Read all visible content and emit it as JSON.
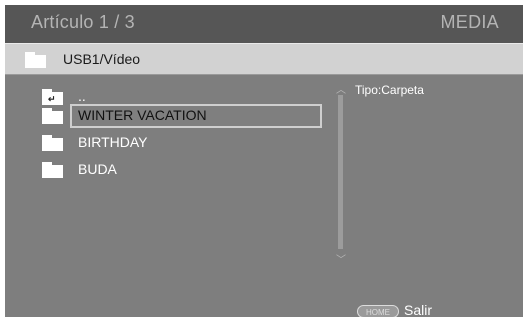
{
  "header": {
    "item_counter": "Artículo 1 / 3",
    "mode": "MEDIA"
  },
  "path": {
    "current": "USB1/Vídeo"
  },
  "list": {
    "items": [
      {
        "label": "..",
        "type": "parent",
        "selected": false
      },
      {
        "label": "WINTER VACATION",
        "type": "folder",
        "selected": true
      },
      {
        "label": "BIRTHDAY",
        "type": "folder",
        "selected": false
      },
      {
        "label": "BUDA",
        "type": "folder",
        "selected": false
      }
    ]
  },
  "info": {
    "type_text": "Tipo:Carpeta"
  },
  "footer": {
    "home_button": "HOME",
    "home_label": "Salir"
  },
  "colors": {
    "frame": "#7e7e7e",
    "title_bar": "#565656",
    "path_bar": "#d2d2d2",
    "selection_border": "#cfcfcf"
  },
  "icons": {
    "folder": "folder-icon",
    "parent": "parent-folder-icon",
    "scroll_up": "chevron-up-icon",
    "scroll_down": "chevron-down-icon"
  }
}
